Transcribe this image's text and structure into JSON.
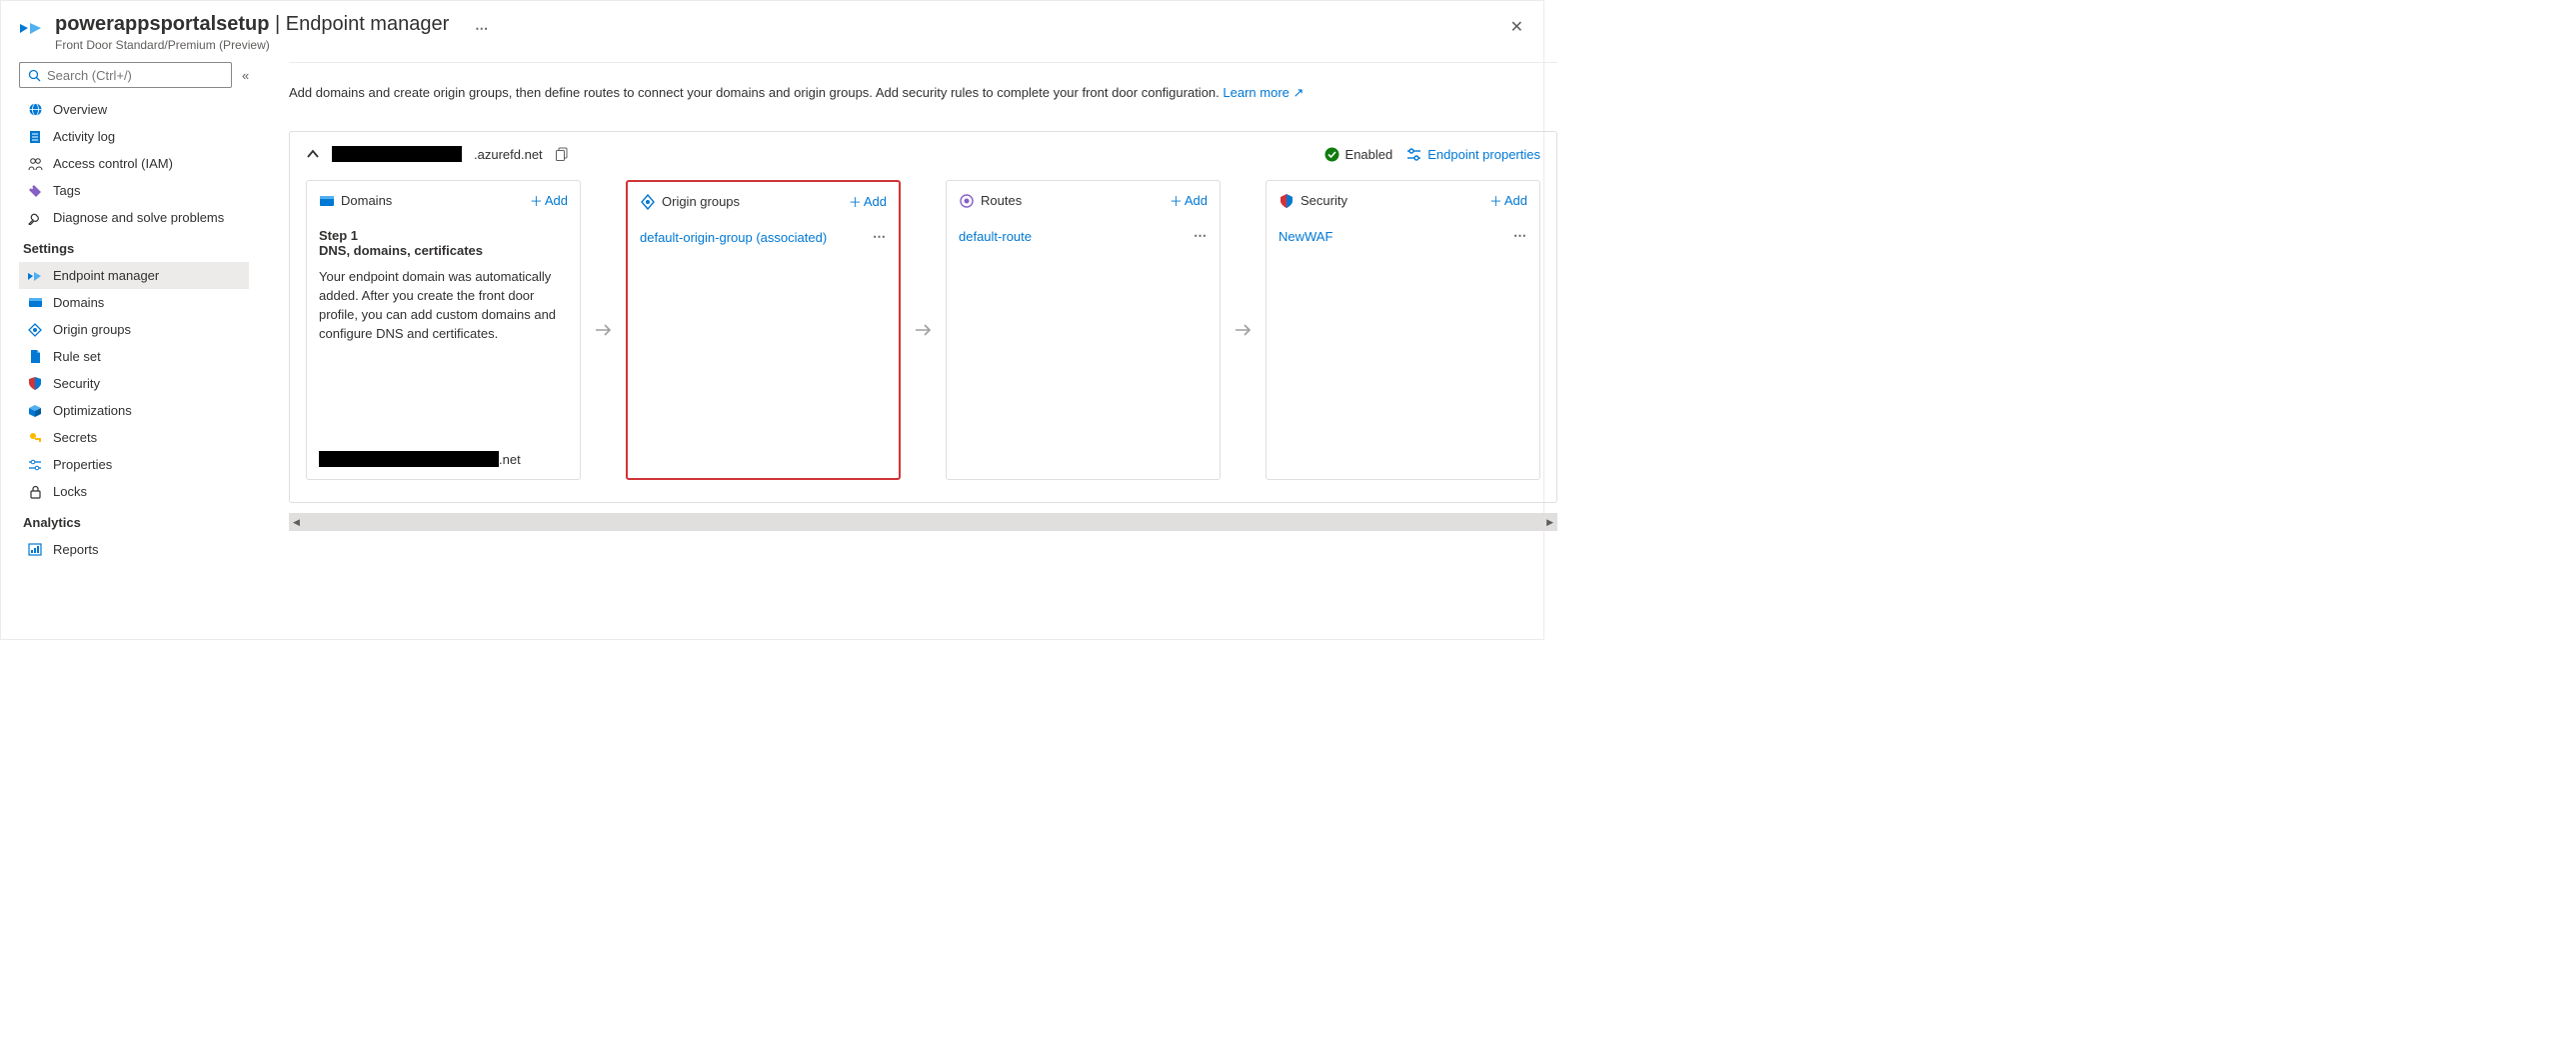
{
  "header": {
    "resource": "powerappsportalsetup",
    "page": "Endpoint manager",
    "subtitle": "Front Door Standard/Premium (Preview)"
  },
  "search": {
    "placeholder": "Search (Ctrl+/)"
  },
  "nav": {
    "top": [
      {
        "icon": "globe-blue",
        "label": "Overview"
      },
      {
        "icon": "log-blue",
        "label": "Activity log"
      },
      {
        "icon": "people",
        "label": "Access control (IAM)"
      },
      {
        "icon": "tag-purple",
        "label": "Tags"
      },
      {
        "icon": "wrench",
        "label": "Diagnose and solve problems"
      }
    ],
    "settings_head": "Settings",
    "settings": [
      {
        "icon": "fd-logo-small",
        "label": "Endpoint manager",
        "active": true
      },
      {
        "icon": "card-blue",
        "label": "Domains"
      },
      {
        "icon": "origin-blue",
        "label": "Origin groups"
      },
      {
        "icon": "doc-blue",
        "label": "Rule set"
      },
      {
        "icon": "shield-multi",
        "label": "Security"
      },
      {
        "icon": "cube-blue",
        "label": "Optimizations"
      },
      {
        "icon": "key-yellow",
        "label": "Secrets"
      },
      {
        "icon": "sliders",
        "label": "Properties"
      },
      {
        "icon": "lock",
        "label": "Locks"
      }
    ],
    "analytics_head": "Analytics",
    "analytics": [
      {
        "icon": "report-blue",
        "label": "Reports"
      }
    ]
  },
  "main": {
    "description": "Add domains and create origin groups, then define routes to connect your domains and origin groups. Add security rules to complete your front door configuration.",
    "learn_more": "Learn more"
  },
  "endpoint": {
    "host_suffix": ".azurefd.net",
    "status": "Enabled",
    "props_link": "Endpoint properties",
    "tiles": {
      "domains": {
        "title": "Domains",
        "add": "Add",
        "step_label": "Step 1",
        "step_title": "DNS, domains, certificates",
        "step_desc": "Your endpoint domain was automatically added. After you create the front door profile, you can add custom domains and configure DNS and certificates.",
        "domain_suffix": ".net"
      },
      "origin": {
        "title": "Origin groups",
        "add": "Add",
        "item": "default-origin-group (associated)"
      },
      "routes": {
        "title": "Routes",
        "add": "Add",
        "item": "default-route"
      },
      "security": {
        "title": "Security",
        "add": "Add",
        "item": "NewWAF"
      }
    }
  }
}
